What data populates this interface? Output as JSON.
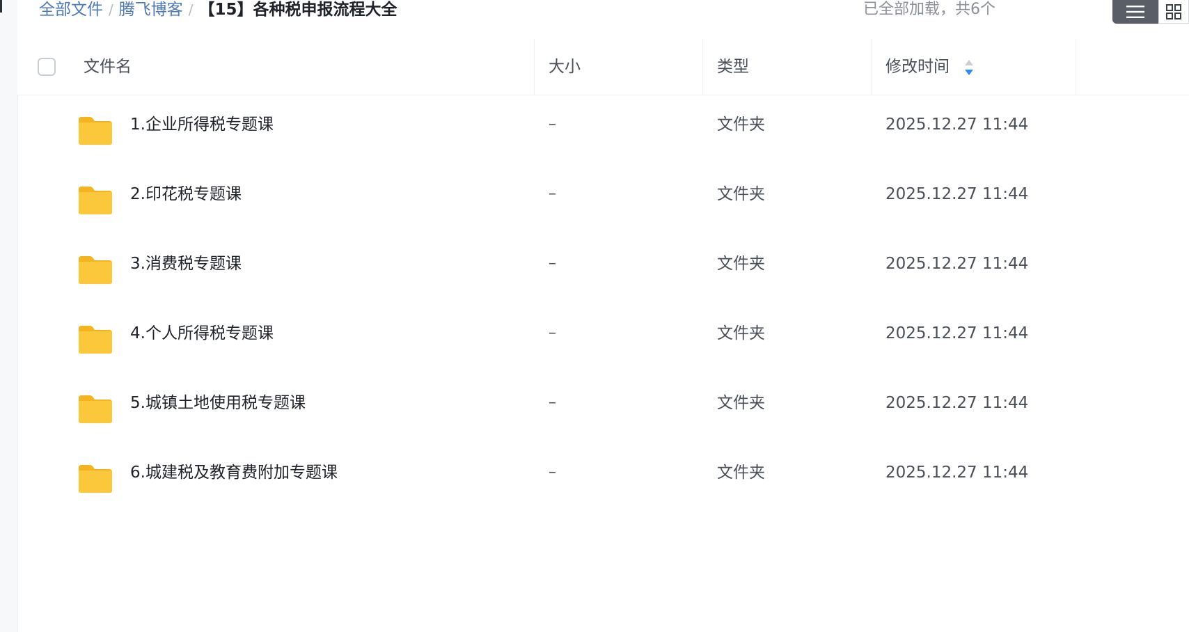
{
  "breadcrumb": {
    "root": "全部文件",
    "parent": "腾飞博客",
    "current": "【15】各种税申报流程大全",
    "separator": "/"
  },
  "status": {
    "load_text": "已全部加载，共6个"
  },
  "view_switch": {
    "active": "list"
  },
  "table": {
    "columns": {
      "name": "文件名",
      "size": "大小",
      "type": "类型",
      "modified": "修改时间"
    },
    "rows": [
      {
        "name": "1.企业所得税专题课",
        "size": "–",
        "type": "文件夹",
        "modified": "2025.12.27 11:44"
      },
      {
        "name": "2.印花税专题课",
        "size": "–",
        "type": "文件夹",
        "modified": "2025.12.27 11:44"
      },
      {
        "name": "3.消费税专题课",
        "size": "–",
        "type": "文件夹",
        "modified": "2025.12.27 11:44"
      },
      {
        "name": "4.个人所得税专题课",
        "size": "–",
        "type": "文件夹",
        "modified": "2025.12.27 11:44"
      },
      {
        "name": "5.城镇土地使用税专题课",
        "size": "–",
        "type": "文件夹",
        "modified": "2025.12.27 11:44"
      },
      {
        "name": "6.城建税及教育费附加专题课",
        "size": "–",
        "type": "文件夹",
        "modified": "2025.12.27 11:44"
      }
    ]
  },
  "colors": {
    "link": "#4e78b8",
    "folder": "#fbc531",
    "sort_active": "#2f8cf0"
  }
}
